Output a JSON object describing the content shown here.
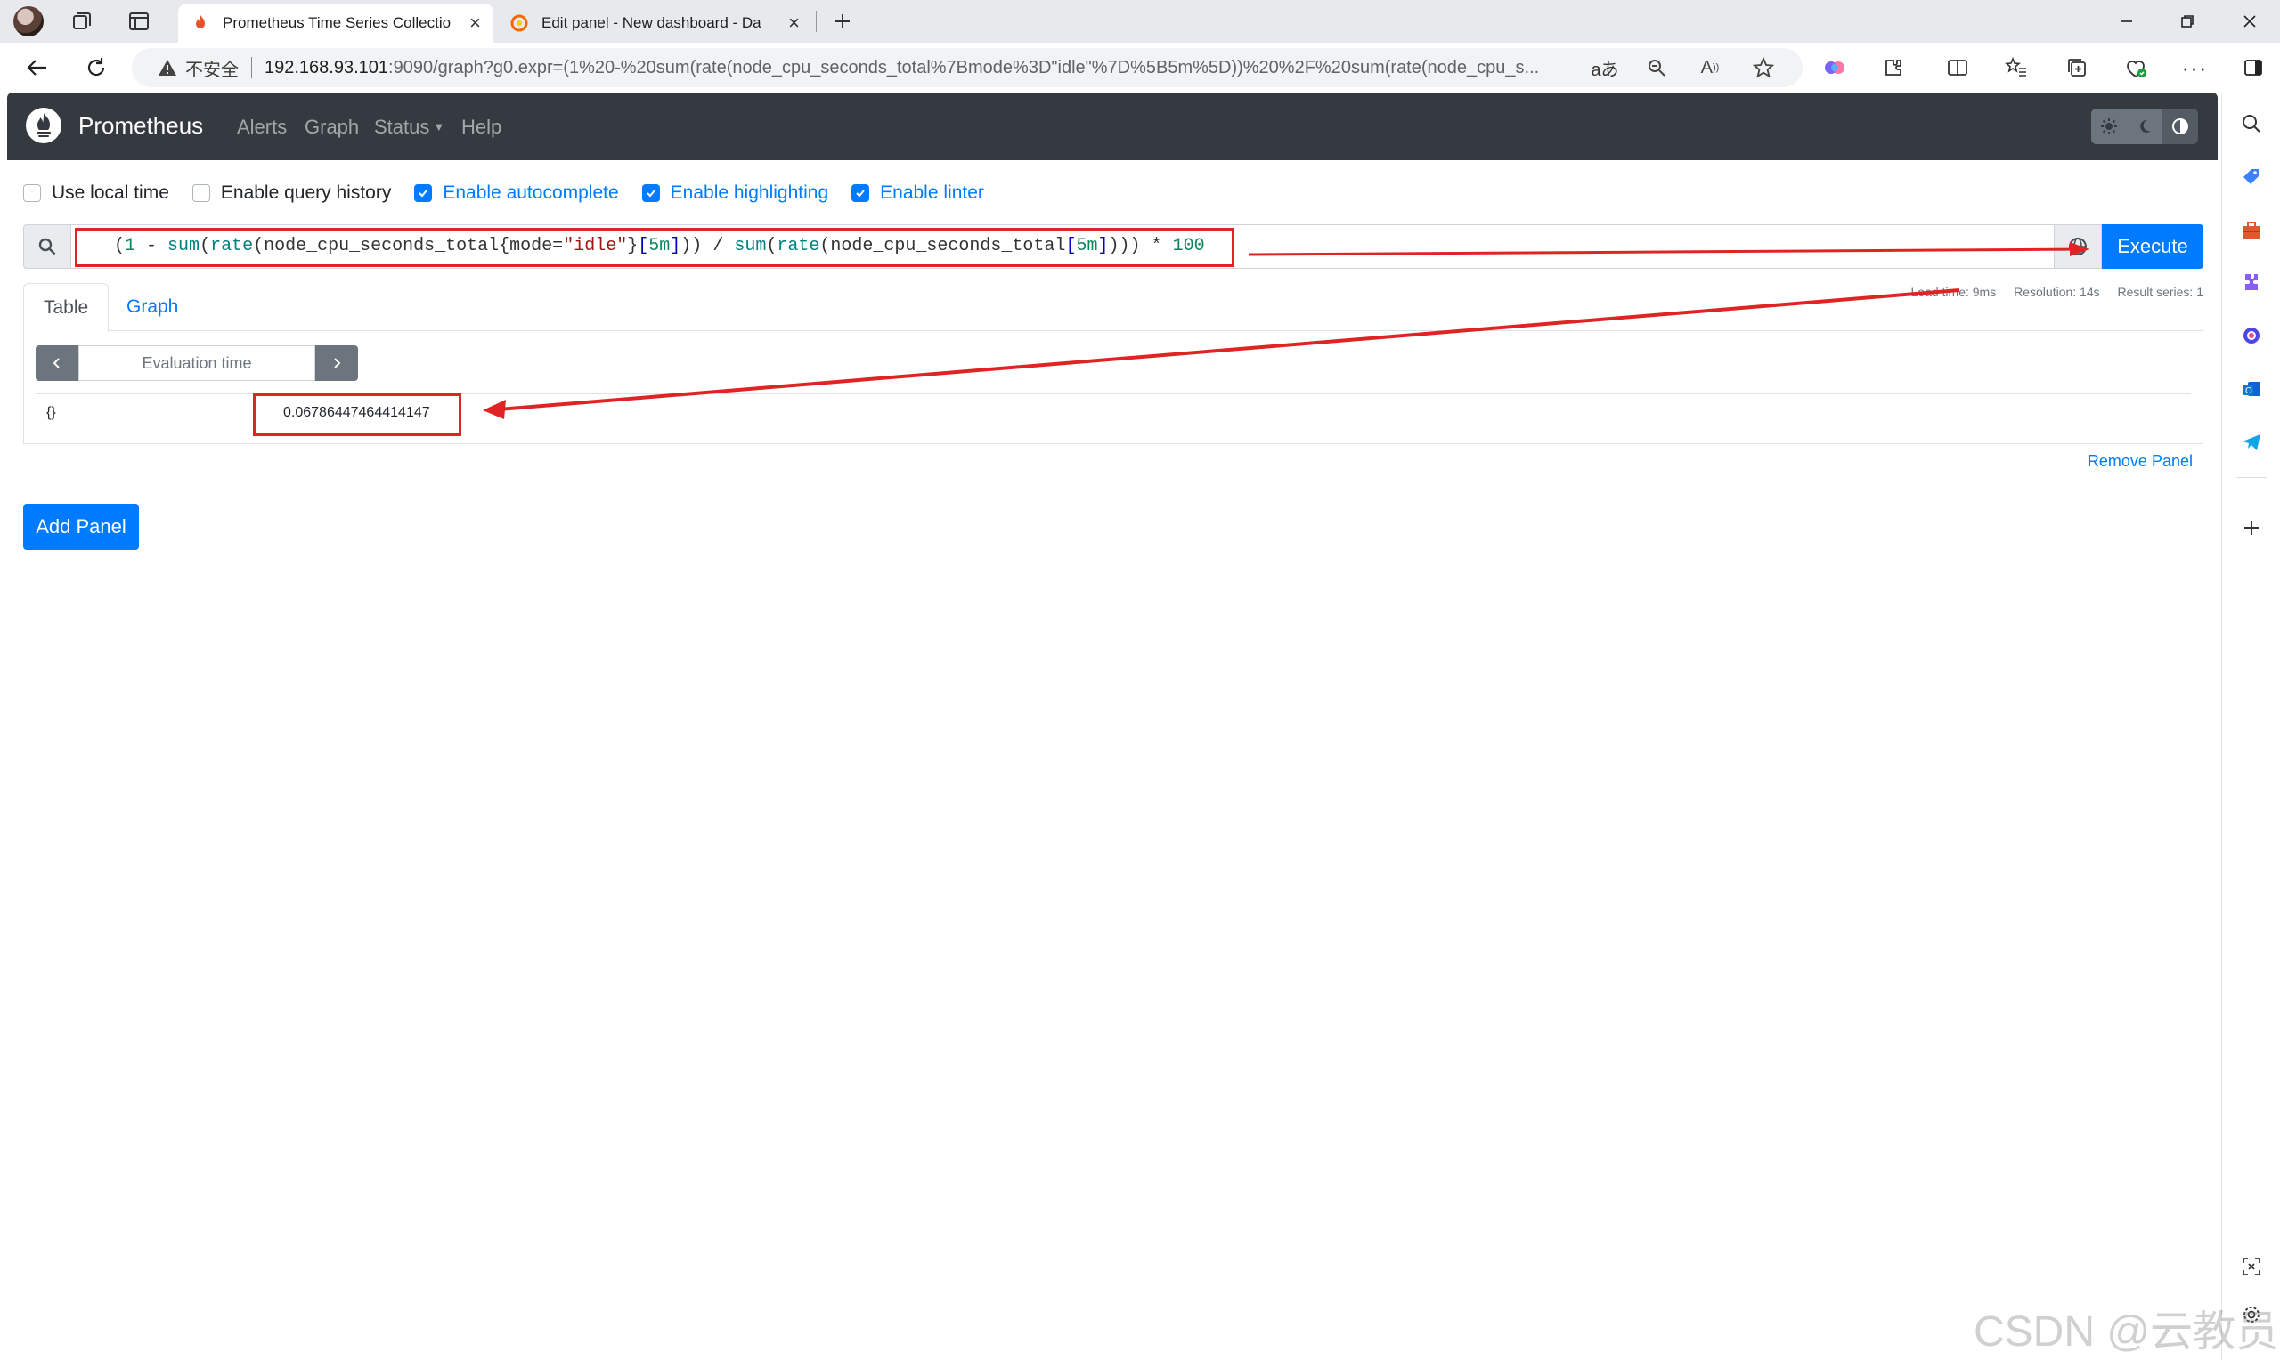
{
  "browser": {
    "tabs": [
      {
        "title": "Prometheus Time Series Collectio",
        "active": true
      },
      {
        "title": "Edit panel - New dashboard - Da",
        "active": false
      }
    ],
    "address": {
      "security_label": "不安全",
      "host": "192.168.93.101",
      "path": ":9090/graph?g0.expr=(1%20-%20sum(rate(node_cpu_seconds_total%7Bmode%3D\"idle\"%7D%5B5m%5D))%20%2F%20sum(rate(node_cpu_s..."
    }
  },
  "prometheus": {
    "brand": "Prometheus",
    "nav": {
      "alerts": "Alerts",
      "graph": "Graph",
      "status": "Status",
      "help": "Help"
    },
    "options": [
      {
        "label": "Use local time",
        "checked": false
      },
      {
        "label": "Enable query history",
        "checked": false
      },
      {
        "label": "Enable autocomplete",
        "checked": true
      },
      {
        "label": "Enable highlighting",
        "checked": true
      },
      {
        "label": "Enable linter",
        "checked": true
      }
    ],
    "expression": "(1 - sum(rate(node_cpu_seconds_total{mode=\"idle\"}[5m])) / sum(rate(node_cpu_seconds_total[5m]))) * 100",
    "execute_label": "Execute",
    "stats": {
      "load_time": "Load time: 9ms",
      "resolution": "Resolution: 14s",
      "result_series": "Result series: 1"
    },
    "panel_tabs": {
      "table": "Table",
      "graph": "Graph"
    },
    "eval_placeholder": "Evaluation time",
    "result": {
      "labels": "{}",
      "value": "0.06786447464414147"
    },
    "remove_panel": "Remove Panel",
    "add_panel": "Add Panel"
  },
  "watermark": "CSDN @云教员",
  "colors": {
    "accent": "#007bff",
    "navbar": "#343a40",
    "annotation": "#e02424"
  },
  "icons": [
    "search-icon",
    "chevron-left-icon",
    "chevron-right-icon",
    "sun-icon",
    "moon-icon",
    "contrast-icon",
    "globe-icon",
    "warning-icon",
    "refresh-icon",
    "back-icon",
    "star-icon",
    "plus-icon"
  ]
}
